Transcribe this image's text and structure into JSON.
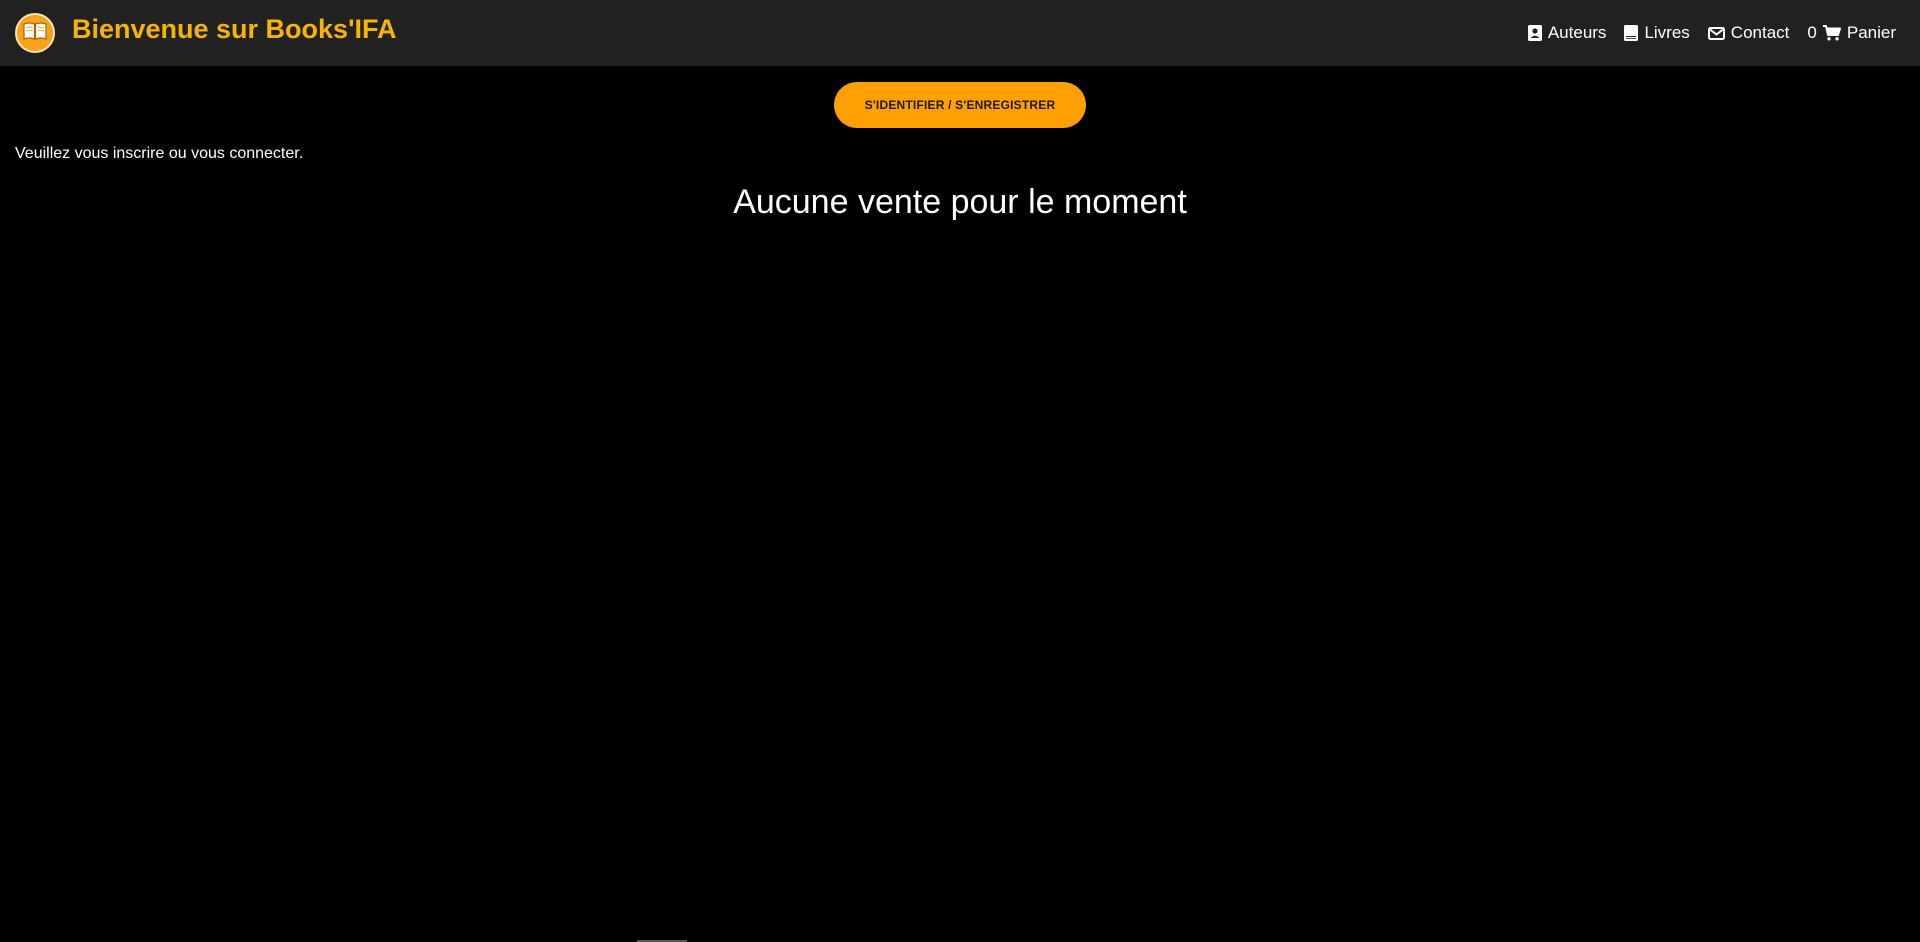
{
  "header": {
    "logo_icon": "open-book-icon",
    "title": "Bienvenue sur Books'IFA",
    "nav": {
      "authors": "Auteurs",
      "books": "Livres",
      "contact": "Contact",
      "cart_count": "0",
      "cart": "Panier"
    }
  },
  "main": {
    "login_button": "S'IDENTIFIER / S'ENREGISTRER",
    "info": "Veuillez vous inscrire ou vous connecter.",
    "headline": "Aucune vente pour le moment"
  },
  "colors": {
    "accent": "#ff9f00",
    "brand_text": "#f7b500",
    "header_bg": "#212121",
    "page_bg": "#000000"
  }
}
